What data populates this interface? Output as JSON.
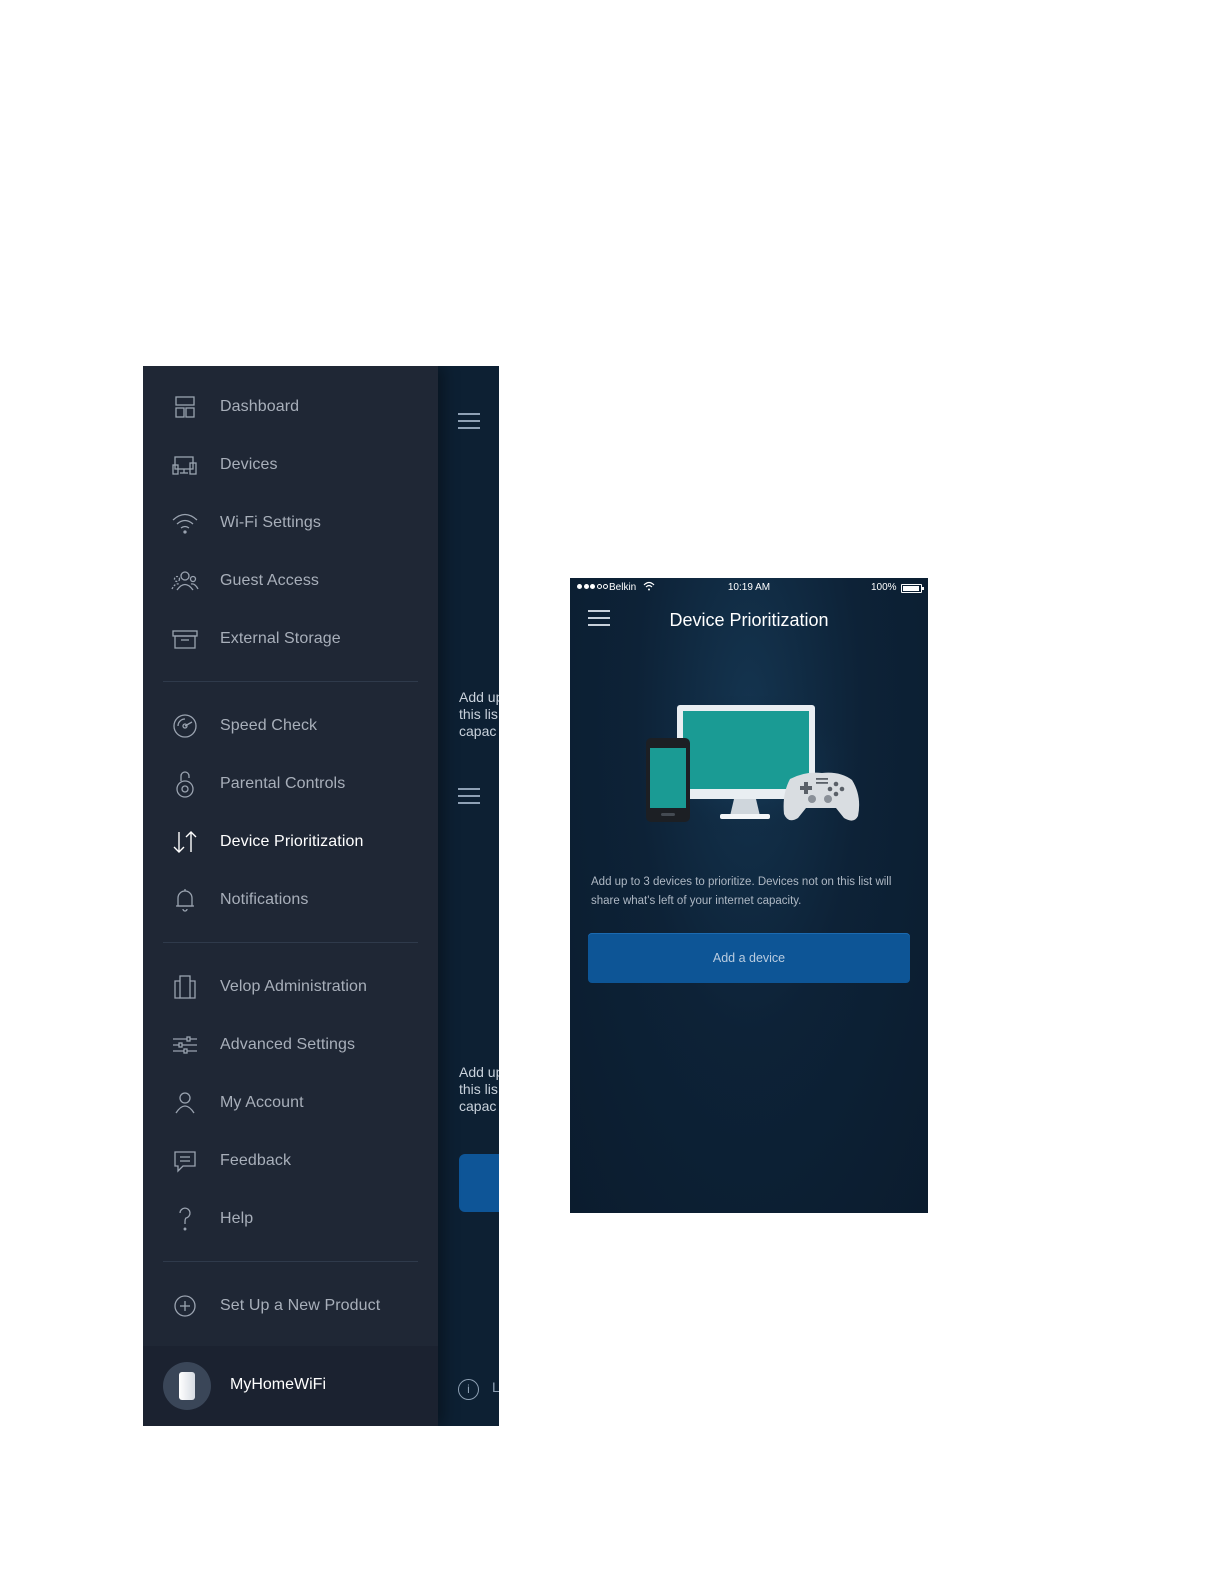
{
  "left_screen": {
    "menu_items": [
      {
        "label": "Dashboard",
        "icon": "dashboard-icon"
      },
      {
        "label": "Devices",
        "icon": "devices-icon"
      },
      {
        "label": "Wi-Fi Settings",
        "icon": "wifi-icon"
      },
      {
        "label": "Guest Access",
        "icon": "guest-access-icon"
      },
      {
        "label": "External Storage",
        "icon": "external-storage-icon"
      },
      {
        "label": "Speed Check",
        "icon": "speed-check-icon"
      },
      {
        "label": "Parental Controls",
        "icon": "parental-controls-icon"
      },
      {
        "label": "Device Prioritization",
        "icon": "device-prioritization-icon",
        "active": true
      },
      {
        "label": "Notifications",
        "icon": "notifications-icon"
      },
      {
        "label": "Velop Administration",
        "icon": "velop-administration-icon"
      },
      {
        "label": "Advanced Settings",
        "icon": "advanced-settings-icon"
      },
      {
        "label": "My Account",
        "icon": "my-account-icon"
      },
      {
        "label": "Feedback",
        "icon": "feedback-icon"
      },
      {
        "label": "Help",
        "icon": "help-icon"
      },
      {
        "label": "Set Up a New Product",
        "icon": "add-circle-icon"
      }
    ],
    "network_name": "MyHomeWiFi",
    "peek_text_1": "Add up\nthis lis\ncapac",
    "peek_text_2": "Add up\nthis lis\ncapac",
    "peek_info_edge": "L"
  },
  "right_screen": {
    "status": {
      "carrier": "Belkin",
      "time": "10:19 AM",
      "battery": "100%"
    },
    "title": "Device Prioritization",
    "description": "Add up to 3 devices to prioritize. Devices not on this list will share what's left of your internet capacity.",
    "add_button": "Add a device"
  },
  "colors": {
    "menu_bg": "#1f2735",
    "app_bg": "#0d2033",
    "button_blue": "#0d5596",
    "screen_teal": "#1a9b94"
  }
}
